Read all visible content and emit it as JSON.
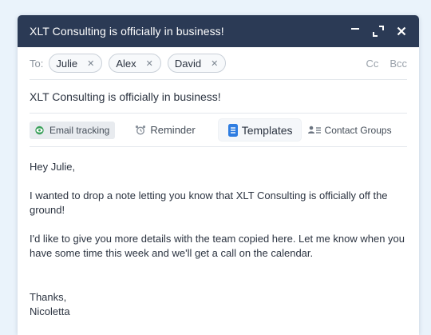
{
  "window": {
    "title": "XLT Consulting is officially in business!"
  },
  "recipients": {
    "to_label": "To:",
    "chips": [
      "Julie",
      "Alex",
      "David"
    ],
    "cc_label": "Cc",
    "bcc_label": "Bcc"
  },
  "subject": "XLT Consulting is officially in business!",
  "toolbar": {
    "email_tracking": "Email tracking",
    "reminder": "Reminder",
    "templates": "Templates",
    "contact_groups": "Contact Groups"
  },
  "message": {
    "greeting": "Hey Julie,",
    "paragraph1": "I wanted to drop a note letting you know that XLT Consulting is officially off the ground!",
    "paragraph2": "I'd like to give you more details with the team copied here. Let me know when you have some time this week and we'll get a call on the calendar.",
    "signoff": "Thanks,",
    "signature": "Nicoletta"
  },
  "colors": {
    "titlebar": "#2b3a55",
    "background": "#eaf3fb",
    "tracking_icon": "#3aa05a",
    "templates_icon": "#2f7de1"
  }
}
